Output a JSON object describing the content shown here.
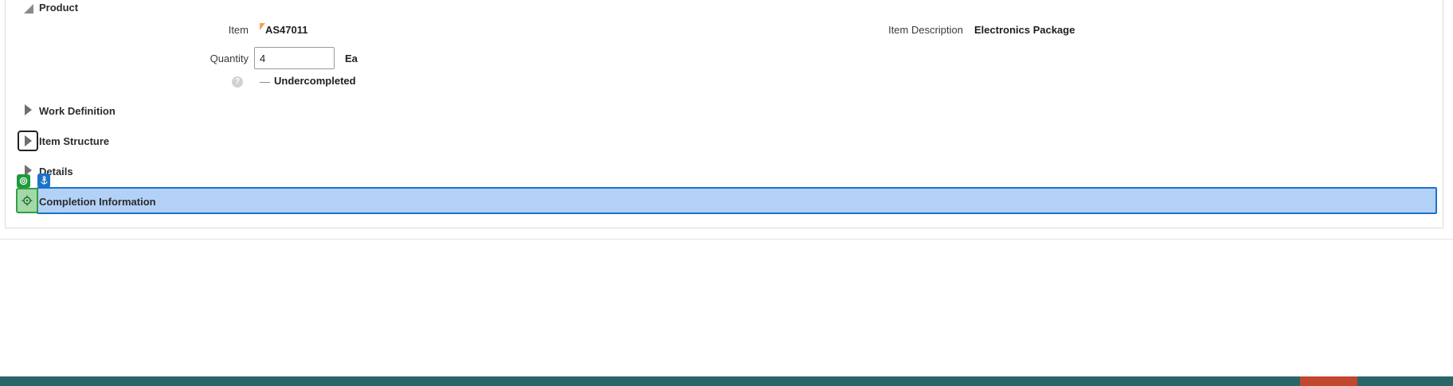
{
  "sections": {
    "product": {
      "title": "Product"
    },
    "work_definition": {
      "title": "Work Definition"
    },
    "item_structure": {
      "title": "Item Structure"
    },
    "details": {
      "title": "Details"
    },
    "completion_information": {
      "title": "Completion Information"
    }
  },
  "fields": {
    "item": {
      "label": "Item",
      "value": "AS47011"
    },
    "item_description": {
      "label": "Item Description",
      "value": "Electronics Package"
    },
    "quantity": {
      "label": "Quantity",
      "value": "4",
      "uom": "Ea"
    },
    "status": {
      "help_glyph": "?",
      "value": "Undercompleted"
    }
  },
  "icons": {
    "expanded": "triangle-expanded-icon",
    "collapsed": "triangle-right-icon",
    "target": "crosshair-icon",
    "anchor": "anchor-icon"
  },
  "colors": {
    "highlight_fill": "#b3d1f7",
    "highlight_border": "#1a73c9",
    "badge_green": "#1f9a3a",
    "footer": "#2a6569",
    "footer_accent": "#c2472f",
    "flag": "#f0a24f"
  }
}
